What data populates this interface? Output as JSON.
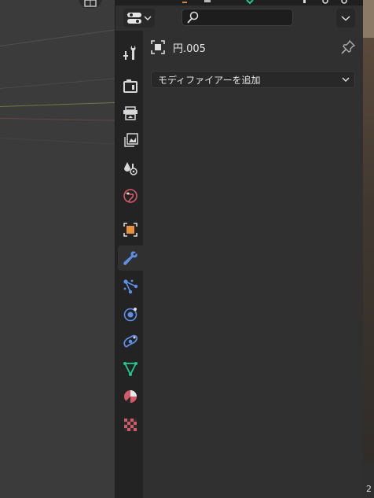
{
  "object": {
    "name": "円.005"
  },
  "modifier": {
    "add_label": "モディファイアーを追加"
  },
  "search": {
    "placeholder": ""
  },
  "right_edge": {
    "text": "2"
  },
  "tabs": [
    {
      "name": "tool",
      "icon": "tool-settings-icon",
      "color": "#d8d8d8"
    },
    {
      "name": "render",
      "icon": "render-icon",
      "color": "#d8d8d8"
    },
    {
      "name": "output",
      "icon": "output-icon",
      "color": "#d8d8d8"
    },
    {
      "name": "view-layer",
      "icon": "view-layer-icon",
      "color": "#d8d8d8"
    },
    {
      "name": "scene",
      "icon": "scene-icon",
      "color": "#d8d8d8"
    },
    {
      "name": "world",
      "icon": "world-icon",
      "color": "#d45a6a"
    },
    {
      "name": "object",
      "icon": "object-icon",
      "color": "#e9913b"
    },
    {
      "name": "modifiers",
      "icon": "wrench-icon",
      "color": "#5d8ee8",
      "active": true
    },
    {
      "name": "particles",
      "icon": "particles-icon",
      "color": "#5d8ee8"
    },
    {
      "name": "physics",
      "icon": "physics-icon",
      "color": "#5d8ee8"
    },
    {
      "name": "constraints",
      "icon": "constraints-icon",
      "color": "#5d8ee8"
    },
    {
      "name": "data",
      "icon": "mesh-data-icon",
      "color": "#22c98f"
    },
    {
      "name": "material",
      "icon": "material-icon",
      "color": "#d45a6a"
    },
    {
      "name": "texture",
      "icon": "texture-icon",
      "color": "#d45a6a"
    }
  ]
}
